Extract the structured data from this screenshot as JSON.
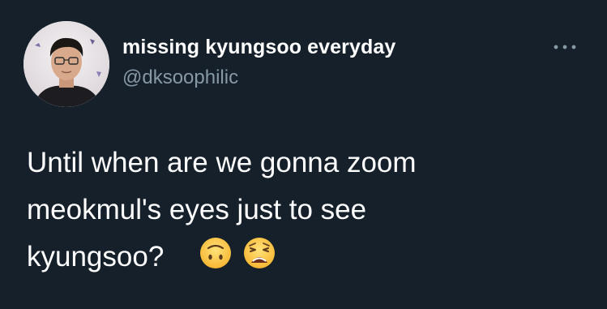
{
  "author": {
    "display_name": "missing kyungsoo everyday",
    "handle": "@dksoophilic"
  },
  "tweet": {
    "text_lines": [
      "Until when are we gonna zoom",
      "meokmul's eyes just to see",
      "kyungsoo?"
    ],
    "emojis": [
      "upside-down-face",
      "weary-face"
    ]
  },
  "menu": {
    "icon": "more-horizontal-icon"
  },
  "colors": {
    "background": "#15202b",
    "name": "#ffffff",
    "handle": "#8899a6",
    "text": "#ffffff",
    "menu_dots": "#8899a6"
  }
}
